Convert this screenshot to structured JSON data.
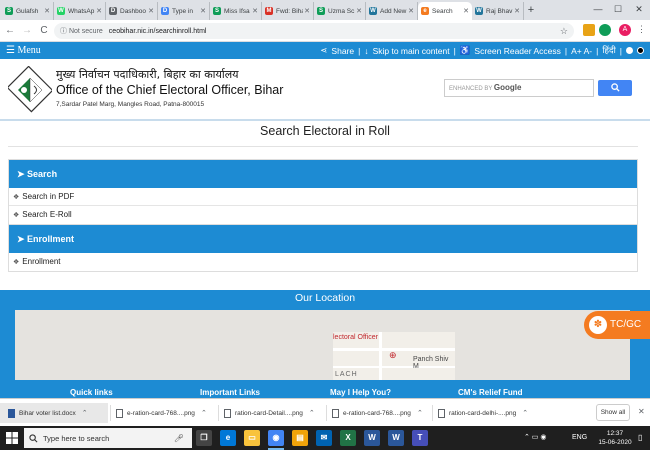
{
  "browser": {
    "tabs": [
      {
        "label": "Gulafsh",
        "icon": "google-sheets-icon",
        "color": "#0f9d58",
        "glyph": "S"
      },
      {
        "label": "WhatsAp",
        "icon": "whatsapp-icon",
        "color": "#25d366",
        "glyph": "W"
      },
      {
        "label": "Dashboo",
        "icon": "dashboard-icon",
        "color": "#5f6368",
        "glyph": "D"
      },
      {
        "label": "Type in",
        "icon": "google-docs-icon",
        "color": "#4285f4",
        "glyph": "D"
      },
      {
        "label": "Miss Ifsa",
        "icon": "google-sheets-icon",
        "color": "#0f9d58",
        "glyph": "S"
      },
      {
        "label": "Fwd: Biha",
        "icon": "gmail-icon",
        "color": "#d93025",
        "glyph": "M"
      },
      {
        "label": "Uzma Sc",
        "icon": "google-sheets-icon",
        "color": "#0f9d58",
        "glyph": "S"
      },
      {
        "label": "Add New",
        "icon": "wordpress-icon",
        "color": "#21759b",
        "glyph": "W"
      },
      {
        "label": "Search",
        "icon": "eci-icon",
        "color": "#f47b20",
        "glyph": "e",
        "active": true
      },
      {
        "label": "Raj Bhav",
        "icon": "wordpress-icon",
        "color": "#21759b",
        "glyph": "W"
      }
    ],
    "new_tab": "+",
    "minimize": "—",
    "maximize": "☐",
    "close": "✕",
    "back": "←",
    "forward": "→",
    "reload": "C",
    "not_secure": "ⓘ Not secure",
    "url": "ceobihar.nic.in/searchinroll.html",
    "star": "☆",
    "profile_initial": "A"
  },
  "menubar": {
    "menu": "☰ Menu",
    "share": "Share",
    "skip": "Skip to main content",
    "screen_reader": "Screen Reader Access",
    "font_size": "A+ A-",
    "hindi": "हिंदी"
  },
  "header": {
    "hindi_title": "मुख्य निर्वाचन पदाधिकारी, बिहार का कार्यालय",
    "office": "Office of the Chief Electoral Officer, Bihar",
    "address": "7,Sardar Patel Marg, Mangles Road, Patna-800015",
    "search_enhanced": "ENHANCED BY",
    "search_google": "Google",
    "search_icon": "search-icon"
  },
  "main": {
    "title": "Search Electoral in Roll",
    "search_panel": {
      "heading": "➤ Search",
      "links": [
        "Search in PDF",
        "Search E-Roll"
      ]
    },
    "enrollment_panel": {
      "heading": "➤ Enrollment",
      "links": [
        "Enrollment"
      ]
    }
  },
  "location": {
    "title": "Our Location",
    "map_label_1": "lectoral Officer",
    "map_label_2": "Panch Shiv M",
    "map_label_3": "LACH",
    "footer_links": [
      "Quick links",
      "Important Links",
      "May I Help You?",
      "CM's Relief Fund"
    ]
  },
  "tcgc": "TC/GC",
  "downloads": [
    {
      "name": "Bihar voter list.docx",
      "type": "word"
    },
    {
      "name": "e-ration-card-768....png",
      "type": "image"
    },
    {
      "name": "ration-card-Detail....png",
      "type": "image"
    },
    {
      "name": "e-ration-card-768....png",
      "type": "image"
    },
    {
      "name": "ration-card-delhi-....png",
      "type": "image"
    }
  ],
  "downloads_show_all": "Show all",
  "downloads_close": "✕",
  "taskbar": {
    "search_placeholder": "Type here to search",
    "apps": [
      {
        "name": "task-view-icon",
        "color": "#444",
        "glyph": "❐"
      },
      {
        "name": "edge-icon",
        "color": "#0078d7",
        "glyph": "e"
      },
      {
        "name": "file-explorer-icon",
        "color": "#f8c33c",
        "glyph": "▭"
      },
      {
        "name": "chrome-icon",
        "color": "#4285f4",
        "glyph": "◉",
        "active": true
      },
      {
        "name": "files-icon",
        "color": "#f0a30a",
        "glyph": "▤"
      },
      {
        "name": "mail-icon",
        "color": "#0063b1",
        "glyph": "✉"
      },
      {
        "name": "excel-icon",
        "color": "#217346",
        "glyph": "X"
      },
      {
        "name": "word-icon",
        "color": "#2b579a",
        "glyph": "W"
      },
      {
        "name": "word-icon-2",
        "color": "#2b579a",
        "glyph": "W"
      },
      {
        "name": "teams-icon",
        "color": "#464eb8",
        "glyph": "T"
      }
    ],
    "language": "ENG",
    "time": "12:37",
    "date": "15-06-2020"
  }
}
